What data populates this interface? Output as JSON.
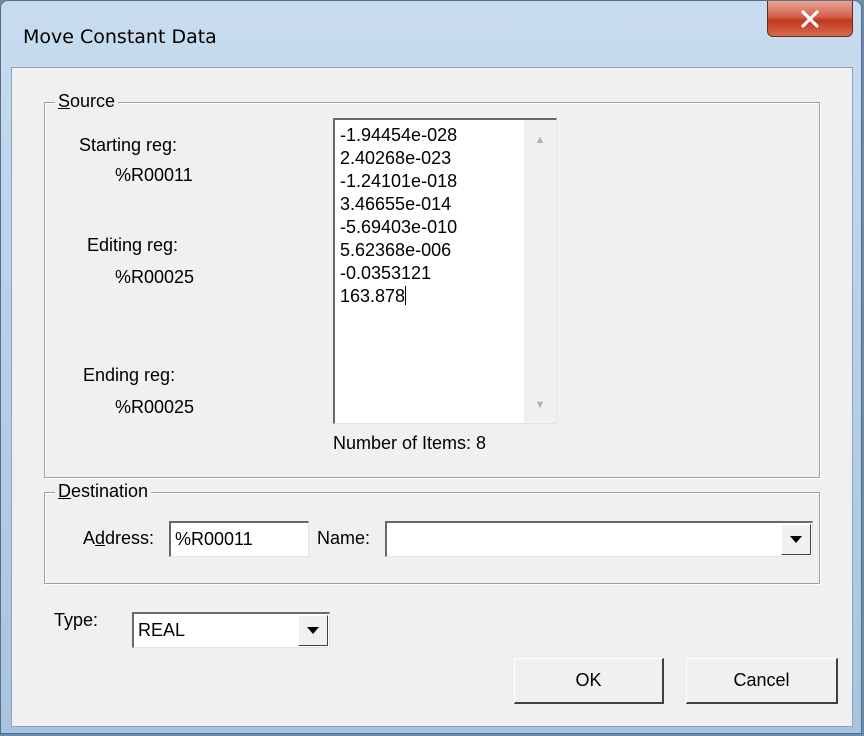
{
  "window": {
    "title": "Move Constant Data",
    "close_glyph": "X"
  },
  "source": {
    "group_title_accel": "S",
    "group_title_rest": "ource",
    "starting_label": "Starting reg:",
    "starting_value": "%R00011",
    "editing_label": "Editing reg:",
    "editing_value": "%R00025",
    "ending_label": "Ending reg:",
    "ending_value": "%R00025",
    "values": [
      "-1.94454e-028",
      "2.40268e-023",
      "-1.24101e-018",
      "3.46655e-014",
      "-5.69403e-010",
      "5.62368e-006",
      "-0.0353121",
      "163.878"
    ],
    "item_count_text": "Number of Items: 8"
  },
  "destination": {
    "group_title_accel": "D",
    "group_title_rest": "estination",
    "address_label_pre": "A",
    "address_label_accel": "d",
    "address_label_post": "dress:",
    "address_value": "%R00011",
    "name_label": "Name:",
    "name_value": ""
  },
  "type": {
    "label": "Type:",
    "value": "REAL"
  },
  "buttons": {
    "ok": "OK",
    "cancel": "Cancel"
  },
  "icons": {
    "close": "close-icon",
    "scroll_up": "scroll-up-arrow-icon",
    "scroll_down": "scroll-down-arrow-icon",
    "dropdown": "chevron-down-icon"
  },
  "colors": {
    "close_button": "#c7462d",
    "dialog_bg": "#f0f0f0",
    "title_gradient": "#b9d1ea"
  }
}
